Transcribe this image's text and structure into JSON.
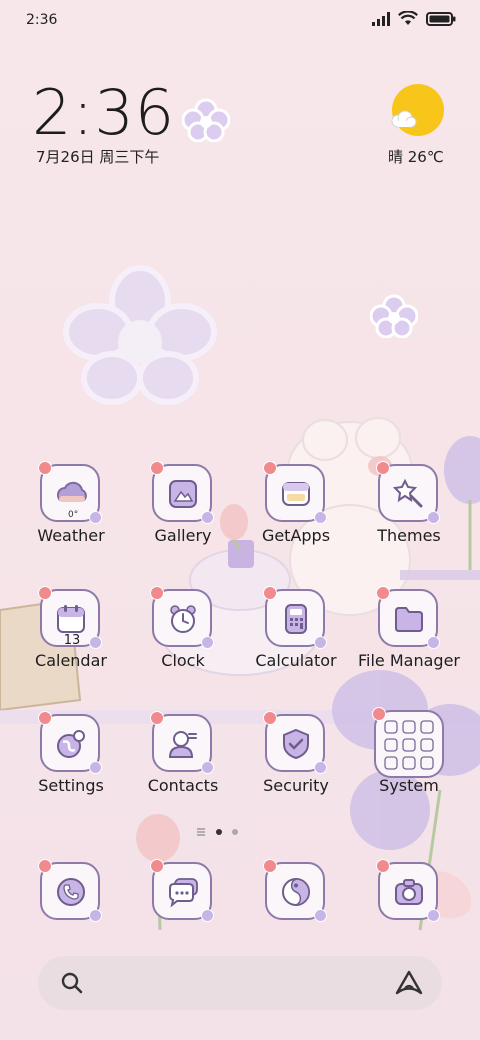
{
  "status_bar": {
    "time": "2:36"
  },
  "clock_widget": {
    "time": "2:36",
    "date": "7月26日 周三下午"
  },
  "weather_widget": {
    "text": "晴 26℃"
  },
  "apps": [
    {
      "label": "Weather",
      "badge": "0°"
    },
    {
      "label": "Gallery"
    },
    {
      "label": "GetApps"
    },
    {
      "label": "Themes"
    },
    {
      "label": "Calendar",
      "badge": "13"
    },
    {
      "label": "Clock"
    },
    {
      "label": "Calculator"
    },
    {
      "label": "File Manager"
    },
    {
      "label": "Settings"
    },
    {
      "label": "Contacts"
    },
    {
      "label": "Security"
    },
    {
      "label": "System"
    }
  ],
  "dock": [
    {
      "icon": "phone-icon"
    },
    {
      "icon": "messages-icon"
    },
    {
      "icon": "browser-icon"
    },
    {
      "icon": "camera-icon"
    }
  ],
  "search": {
    "icon": "search-icon",
    "assistant_icon": "assistant-icon"
  },
  "colors": {
    "tile_border": "#8d7aa9",
    "tile_bg": "#fbf6fa",
    "accent_purple": "#c7b5e7",
    "sun": "#f8c51b"
  }
}
